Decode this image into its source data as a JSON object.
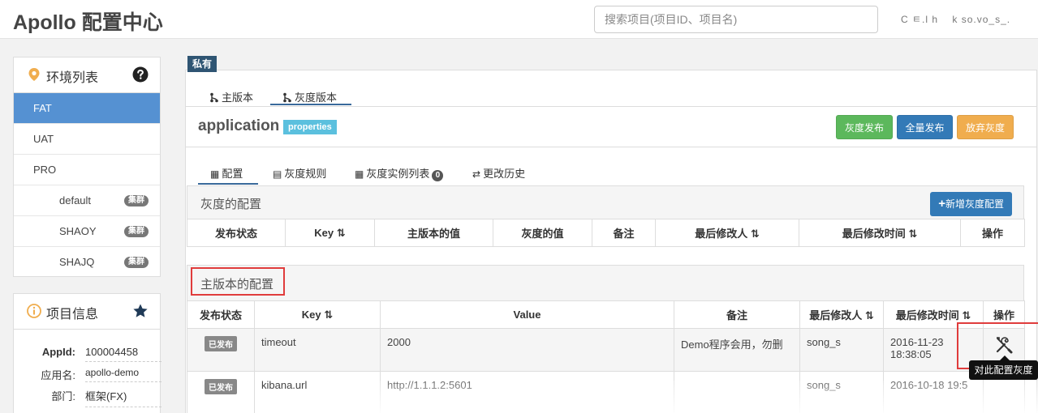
{
  "header": {
    "brand": "Apollo 配置中心",
    "search_placeholder": "搜索项目(项目ID、项目名)",
    "user": "C ㅌ.l h    k so.vo_s_."
  },
  "env_panel": {
    "title": "环境列表",
    "items": [
      {
        "label": "FAT",
        "active": true
      },
      {
        "label": "UAT"
      },
      {
        "label": "PRO"
      }
    ],
    "clusters": [
      {
        "label": "default",
        "badge": "集群"
      },
      {
        "label": "SHAOY",
        "badge": "集群"
      },
      {
        "label": "SHAJQ",
        "badge": "集群"
      }
    ]
  },
  "info_panel": {
    "title": "项目信息",
    "rows": [
      {
        "key": "AppId:",
        "value": "100004458"
      },
      {
        "key": "应用名:",
        "value": "apollo-demo"
      },
      {
        "key": "部门:",
        "value": "框架(FX)"
      }
    ]
  },
  "namespace": {
    "private_tag": "私有",
    "branch_tabs": [
      "主版本",
      "灰度版本"
    ],
    "name": "application",
    "format": "properties",
    "buttons": {
      "gray_release": "灰度发布",
      "full_release": "全量发布",
      "abandon_gray": "放弃灰度"
    },
    "sub_tabs": {
      "config": "配置",
      "gray_rules": "灰度规则",
      "instances": "灰度实例列表",
      "instances_count": "0",
      "history": "更改历史"
    }
  },
  "gray_section": {
    "title": "灰度的配置",
    "add_button": "新增灰度配置",
    "columns": [
      "发布状态",
      "Key",
      "主版本的值",
      "灰度的值",
      "备注",
      "最后修改人",
      "最后修改时间",
      "操作"
    ],
    "sort_mark": "⇅"
  },
  "master_section": {
    "title": "主版本的配置",
    "columns": [
      "发布状态",
      "Key",
      "Value",
      "备注",
      "最后修改人",
      "最后修改时间",
      "操作"
    ],
    "rows": [
      {
        "status": "已发布",
        "key": "timeout",
        "value": "2000",
        "comment": "Demo程序会用，勿删",
        "modifier": "song_s",
        "time": "2016-11-23 18:38:05"
      },
      {
        "status": "已发布",
        "key": "kibana.url",
        "value": "http://1.1.1.2:5601",
        "comment": "",
        "modifier": "song_s",
        "time": "2016-10-18 19:5"
      }
    ],
    "tooltip": "对此配置灰度"
  },
  "colors": {
    "active_env": "#5591d2",
    "primary": "#337ab7",
    "success": "#5cb85c",
    "warning": "#f0ad4e",
    "info": "#5bc0de",
    "highlight": "#e03c3c"
  }
}
